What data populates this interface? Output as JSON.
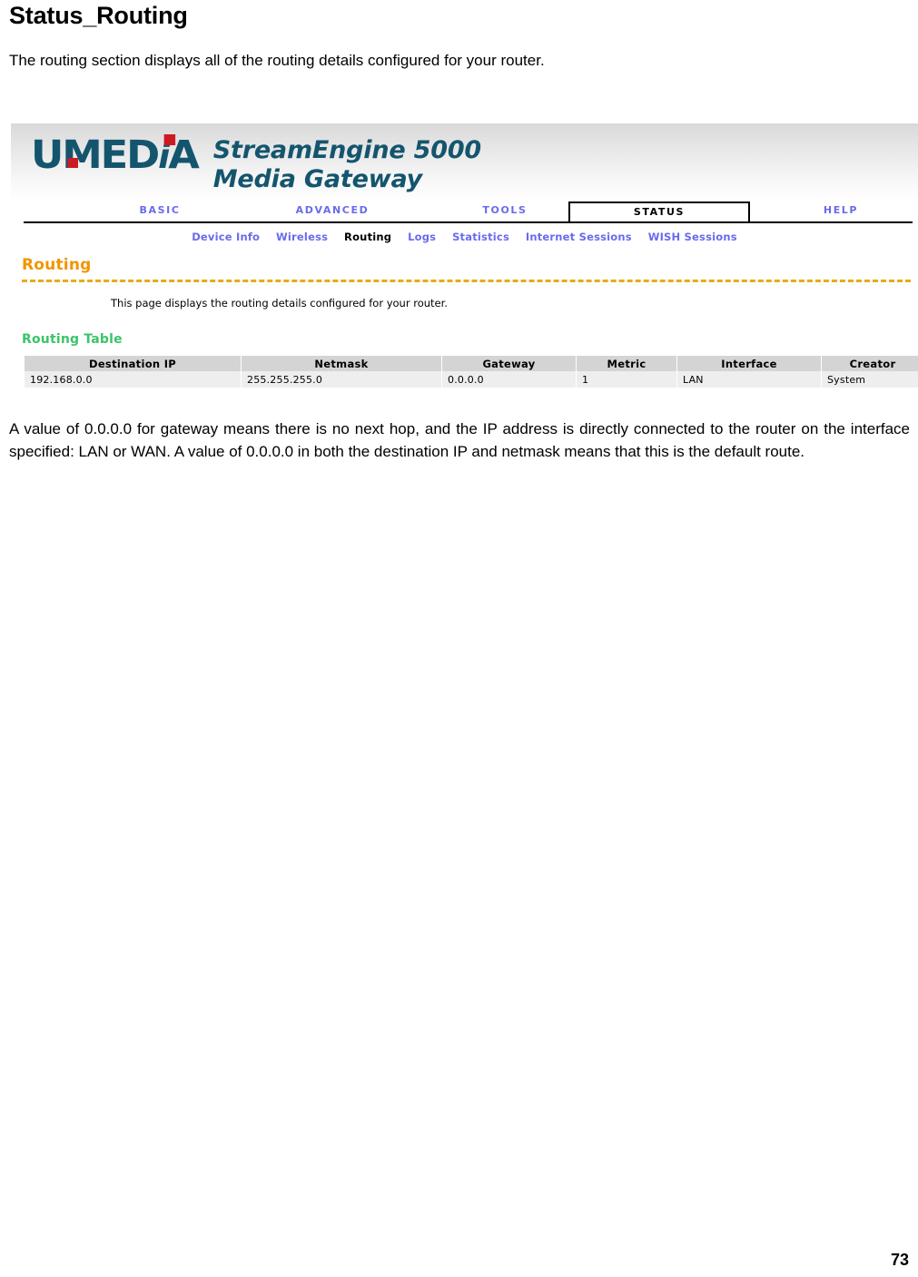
{
  "document": {
    "title": "Status_Routing",
    "intro": "The routing section displays all of the routing details configured for your router.",
    "note": "A value of 0.0.0.0 for gateway means there is no next hop, and the IP address is directly connected to the router on the interface specified: LAN or WAN. A value of 0.0.0.0 in both the destination IP and netmask means that this is the default route.",
    "page_number": "73"
  },
  "router_ui": {
    "brand": {
      "logo_u": "U",
      "logo_med": "MED",
      "logo_i": "i",
      "logo_a": "A",
      "product_line1": "StreamEngine 5000",
      "product_line2": "Media Gateway"
    },
    "tabs": [
      {
        "label": "BASIC",
        "active": false
      },
      {
        "label": "ADVANCED",
        "active": false
      },
      {
        "label": "TOOLS",
        "active": false
      },
      {
        "label": "STATUS",
        "active": true
      },
      {
        "label": "HELP",
        "active": false
      }
    ],
    "subnav": [
      {
        "label": "Device Info",
        "active": false
      },
      {
        "label": "Wireless",
        "active": false
      },
      {
        "label": "Routing",
        "active": true
      },
      {
        "label": "Logs",
        "active": false
      },
      {
        "label": "Statistics",
        "active": false
      },
      {
        "label": "Internet Sessions",
        "active": false
      },
      {
        "label": "WISH Sessions",
        "active": false
      }
    ],
    "section": {
      "heading": "Routing",
      "description": "This page displays the routing details configured for your router."
    },
    "routing_table": {
      "heading": "Routing Table",
      "columns": [
        "Destination IP",
        "Netmask",
        "Gateway",
        "Metric",
        "Interface",
        "Creator"
      ],
      "rows": [
        {
          "destination_ip": "192.168.0.0",
          "netmask": "255.255.255.0",
          "gateway": "0.0.0.0",
          "metric": "1",
          "interface": "LAN",
          "creator": "System"
        }
      ]
    },
    "colors": {
      "brand_teal": "#14556e",
      "brand_red": "#cc1a22",
      "nav_link": "#6a6aee",
      "section_orange": "#f29400",
      "dash_rule": "#e2ae16",
      "table_heading_green": "#3cc36a",
      "table_header_bg": "#d4d4d4",
      "table_row_bg": "#eeeeee"
    }
  }
}
